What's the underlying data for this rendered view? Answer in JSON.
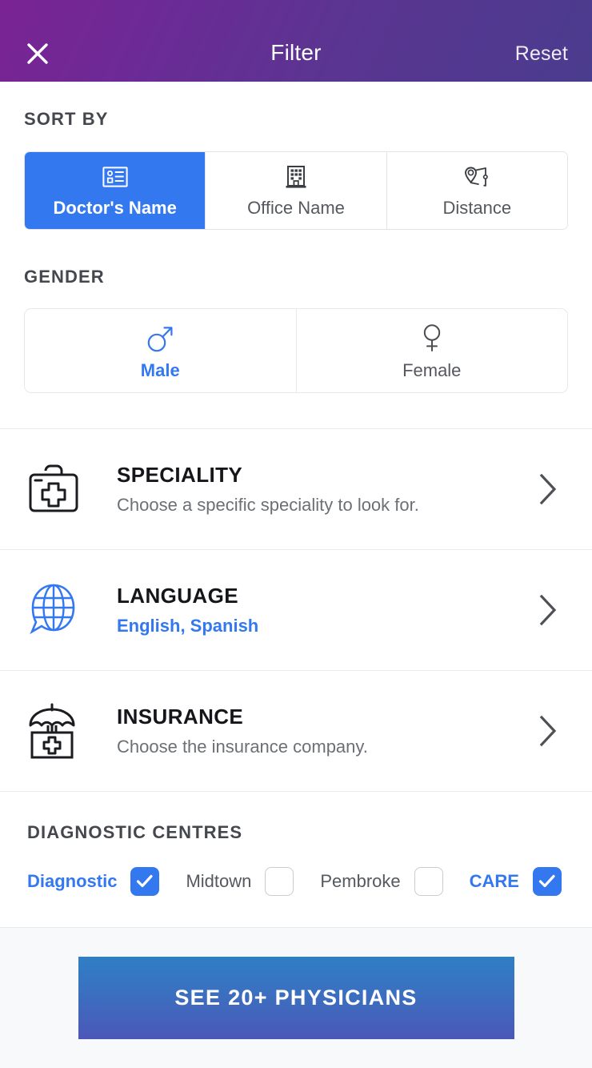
{
  "header": {
    "title": "Filter",
    "close_icon": "close-x-icon",
    "reset_label": "Reset",
    "gradient_from": "#7A2394",
    "gradient_to": "#4A3C8E"
  },
  "accent_color": "#3478F0",
  "sort_by": {
    "label": "SORT BY",
    "options": [
      {
        "label": "Doctor's Name",
        "icon": "id-card-icon",
        "selected": true
      },
      {
        "label": "Office Name",
        "icon": "building-icon",
        "selected": false
      },
      {
        "label": "Distance",
        "icon": "map-route-pin-icon",
        "selected": false
      }
    ]
  },
  "gender": {
    "label": "GENDER",
    "options": [
      {
        "label": "Male",
        "icon": "male-symbol-icon",
        "selected": true
      },
      {
        "label": "Female",
        "icon": "female-symbol-icon",
        "selected": false
      }
    ]
  },
  "rows": [
    {
      "title": "SPECIALITY",
      "subtitle": "Choose a specific speciality to look for.",
      "icon": "medical-briefcase-icon",
      "subtitle_is_value": false
    },
    {
      "title": "LANGUAGE",
      "subtitle": "English, Spanish",
      "icon": "globe-speech-bubble-icon",
      "subtitle_is_value": true
    },
    {
      "title": "INSURANCE",
      "subtitle": "Choose the insurance company.",
      "icon": "umbrella-medical-box-icon",
      "subtitle_is_value": false
    }
  ],
  "diagnostic_centres": {
    "label": "DIAGNOSTIC CENTRES",
    "items": [
      {
        "name": "Diagnostic",
        "checked": true
      },
      {
        "name": "Midtown",
        "checked": false
      },
      {
        "name": "Pembroke",
        "checked": false
      },
      {
        "name": "CARE",
        "checked": true
      }
    ]
  },
  "footer": {
    "cta_label": "SEE 20+ PHYSICIANS"
  }
}
